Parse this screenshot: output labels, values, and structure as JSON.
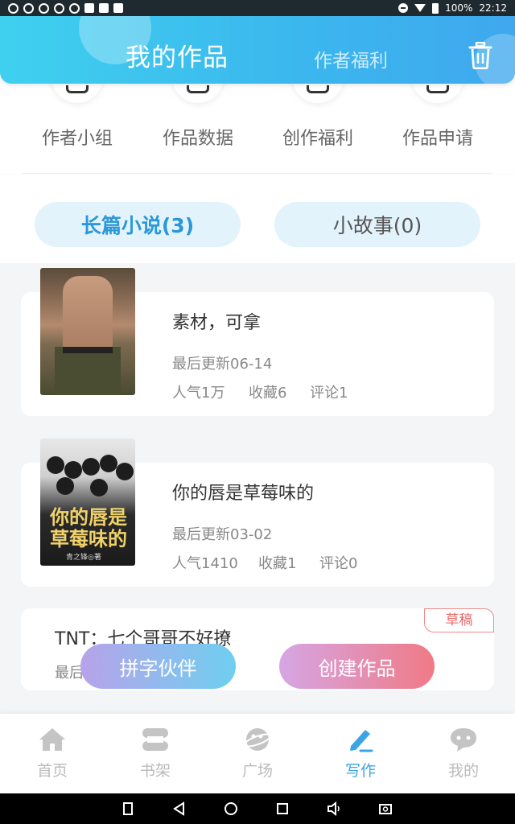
{
  "status_bar": {
    "battery": "100%",
    "time": "22:12"
  },
  "header": {
    "title": "我的作品",
    "tab2": "作者福利"
  },
  "quick_actions": [
    {
      "label": "作者小组"
    },
    {
      "label": "作品数据"
    },
    {
      "label": "创作福利"
    },
    {
      "label": "作品申请"
    }
  ],
  "tabs": [
    {
      "label": "长篇小说(3)",
      "active": true
    },
    {
      "label": "小故事(0)",
      "active": false
    }
  ],
  "works": [
    {
      "title": "素材，可拿",
      "updated": "最后更新06-14",
      "popularity": "人气1万",
      "favorites": "收藏6",
      "comments": "评论1"
    },
    {
      "title": "你的唇是草莓味的",
      "updated": "最后更新03-02",
      "popularity": "人气1410",
      "favorites": "收藏1",
      "comments": "评论0",
      "cover_text": "你的唇是草莓味的",
      "cover_author": "青之锋◎著"
    },
    {
      "title": "TNT：七个哥哥不好撩",
      "updated": "最后",
      "badge": "草稿"
    }
  ],
  "buttons": {
    "partner": "拼字伙伴",
    "create": "创建作品"
  },
  "bottom_nav": [
    {
      "label": "首页",
      "icon": "home-icon"
    },
    {
      "label": "书架",
      "icon": "bookshelf-icon"
    },
    {
      "label": "广场",
      "icon": "planet-icon"
    },
    {
      "label": "写作",
      "icon": "pen-icon",
      "active": true
    },
    {
      "label": "我的",
      "icon": "chat-bubble-icon"
    }
  ],
  "colors": {
    "accent": "#3aa5e6",
    "header_gradient_start": "#3fd0ef",
    "draft_badge": "#e86a6a"
  }
}
